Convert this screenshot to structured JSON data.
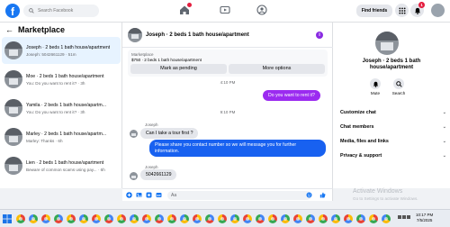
{
  "topbar": {
    "logo": "f",
    "search_placeholder": "Search Facebook",
    "find_friends": "Find friends",
    "notification_count": "1"
  },
  "sidebar": {
    "back": "←",
    "title": "Marketplace",
    "conversations": [
      {
        "name": "Joseph · 2 beds 1 bath house/apartment",
        "preview": "Joseph: 5042661129 · 51m",
        "active": true
      },
      {
        "name": "Moe · 2 beds 1 bath house/apartment",
        "preview": "You: Do you want to rent it? · 3h",
        "active": false
      },
      {
        "name": "Yamila · 2 beds 1 bath house/apartm...",
        "preview": "You: Do you want to rent it? · 3h",
        "active": false
      },
      {
        "name": "Marley · 2 beds 1 bath house/apartm...",
        "preview": "Marley: Thanks · 6h",
        "active": false
      },
      {
        "name": "Lien · 2 beds 1 bath house/apartment",
        "preview": "Beware of common scams using pay... · 6h",
        "active": false
      }
    ]
  },
  "chat": {
    "title": "Joseph · 2 beds 1 bath house/apartment",
    "info_icon": "i",
    "marketplace_label": "Marketplace",
    "listing": "$750 · 2 beds 1 bath house/apartment",
    "mark_pending": "Mark as pending",
    "more_options": "More options",
    "messages": [
      {
        "type": "time",
        "text": "4:10 PM"
      },
      {
        "type": "out",
        "text": "Do you want to rent it?"
      },
      {
        "type": "time",
        "text": "9:10 PM"
      },
      {
        "type": "sender",
        "text": "Joseph"
      },
      {
        "type": "in",
        "text": "Can I take a tour first ?"
      },
      {
        "type": "out",
        "text": "Please share you contact number so we will message you for further information."
      },
      {
        "type": "sender",
        "text": "Joseph"
      },
      {
        "type": "in",
        "text": "5042661129"
      }
    ],
    "composer_placeholder": "Aa"
  },
  "right_panel": {
    "title": "Joseph · 2 beds 1 bath house/apartment",
    "mute": "Mute",
    "search": "Search",
    "rows": [
      "Customize chat",
      "Chat members",
      "Media, files and links",
      "Privacy & support"
    ]
  },
  "watermark": {
    "title": "Activate Windows",
    "subtitle": "Go to Settings to activate Windows."
  },
  "taskbar": {
    "time": "10:17 PM",
    "date": "7/5/2025"
  },
  "colors": {
    "brand": "#1877f2",
    "outgoing_bubble": "#9b2bf0",
    "outgoing_bubble_alt": "#1861f0",
    "active_conversation": "#e7f3ff"
  }
}
